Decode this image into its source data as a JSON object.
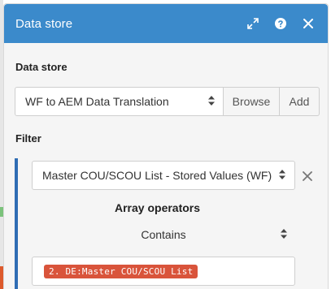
{
  "dialog": {
    "title": "Data store",
    "icons": [
      "expand-icon",
      "help-icon",
      "close-icon"
    ]
  },
  "data_store_section": {
    "label": "Data store",
    "selected": "WF to AEM Data Translation",
    "browse_label": "Browse",
    "add_label": "Add"
  },
  "filter_section": {
    "label": "Filter",
    "field_selected": "Master COU/SCOU List - Stored Values (WF)",
    "operators_label": "Array operators",
    "operator_selected": "Contains",
    "value_pill": "2. DE:Master COU/SCOU List"
  },
  "colors": {
    "header": "#3b8acb",
    "filter_bar": "#2f6db4",
    "pill": "#d9543b"
  }
}
